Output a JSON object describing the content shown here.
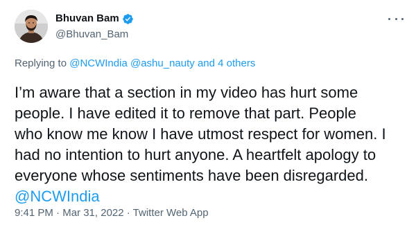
{
  "author": {
    "display_name": "Bhuvan Bam",
    "handle": "@Bhuvan_Bam",
    "verified": true,
    "avatar_icon": "profile-photo"
  },
  "menu": {
    "icon": "more-horizontal-icon"
  },
  "reply_context": {
    "prefix": "Replying to",
    "mentions": [
      "@NCWIndia",
      "@ashu_nauty",
      "and 4 others"
    ]
  },
  "tweet": {
    "text": "I’m aware that a section in my video has hurt some\npeople. I have edited it to remove that part. People\nwho know me know I have utmost respect for women. I\nhad no intention to hurt anyone. A heartfelt apology to\neveryone whose sentiments have been disregarded.",
    "mention": "@NCWIndia"
  },
  "meta": {
    "time": "9:41 PM",
    "separator1": " · ",
    "date": "Mar 31, 2022",
    "separator2": " · ",
    "source": "Twitter Web App"
  },
  "colors": {
    "link": "#1d9bf0",
    "text": "#0f1419",
    "secondary": "#536471",
    "verified": "#1d9bf0"
  }
}
